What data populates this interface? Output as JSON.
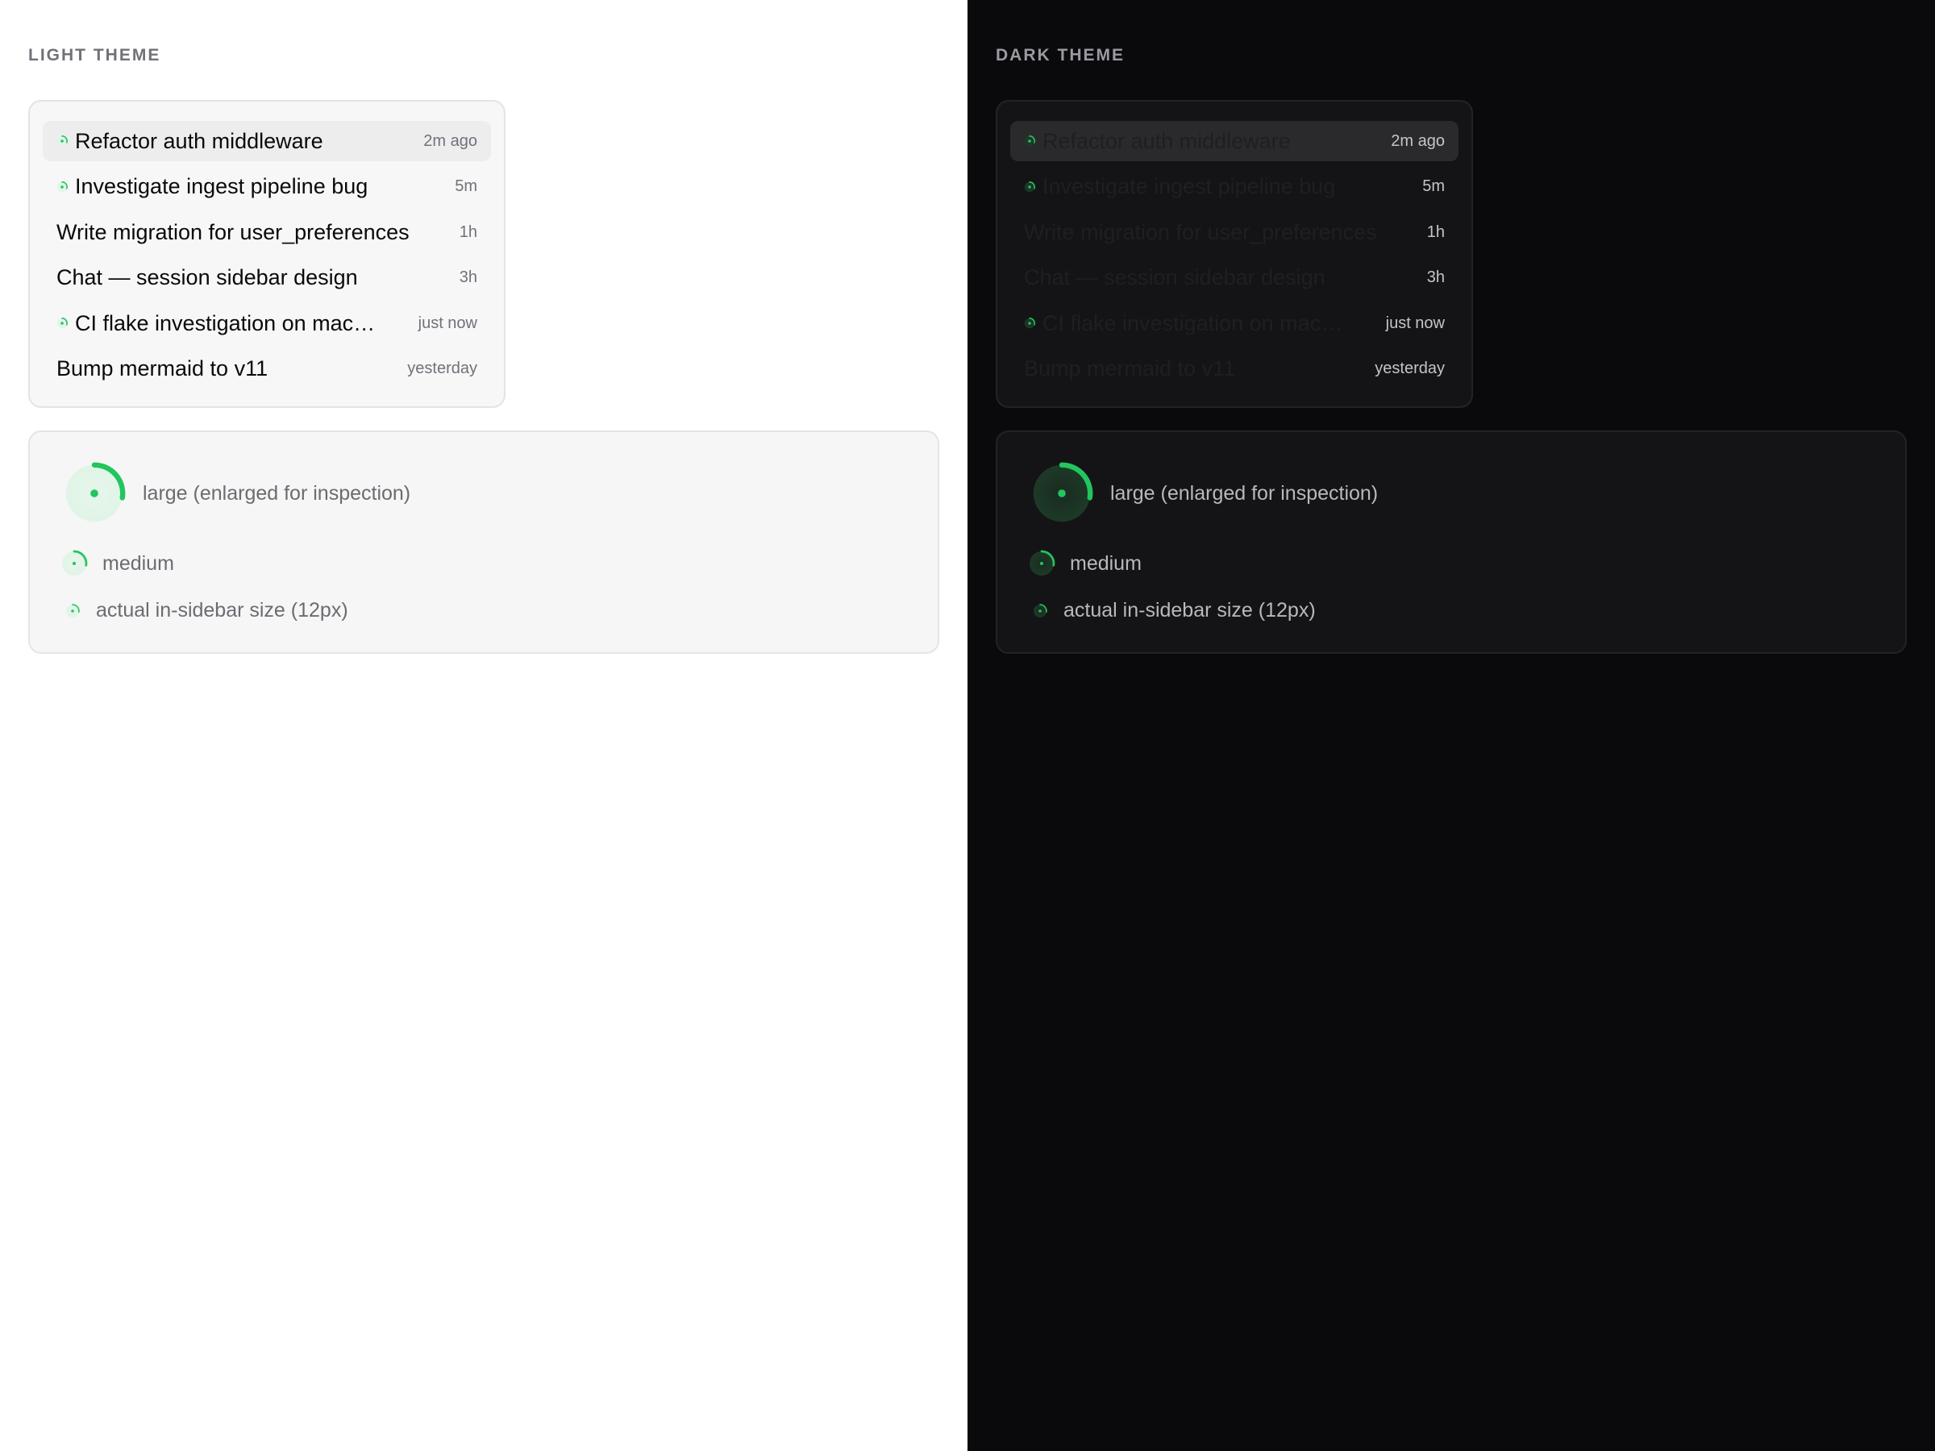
{
  "colors": {
    "accent": "#22c55e",
    "light_bg": "#ffffff",
    "dark_bg": "#0a0a0c"
  },
  "themes": [
    {
      "label": "LIGHT THEME",
      "sessions": [
        {
          "title": "Refactor auth middleware",
          "time": "2m ago",
          "running": true,
          "active": true
        },
        {
          "title": "Investigate ingest pipeline bug",
          "time": "5m",
          "running": true,
          "active": false
        },
        {
          "title": "Write migration for user_preferences",
          "time": "1h",
          "running": false,
          "active": false
        },
        {
          "title": "Chat — session sidebar design",
          "time": "3h",
          "running": false,
          "active": false
        },
        {
          "title": "CI flake investigation on mac…",
          "time": "just now",
          "running": true,
          "active": false
        },
        {
          "title": "Bump mermaid to v11",
          "time": "yesterday",
          "running": false,
          "active": false
        }
      ],
      "demo": {
        "large_label": "large (enlarged for inspection)",
        "medium_label": "medium",
        "small_label": "actual in-sidebar size (12px)"
      }
    },
    {
      "label": "DARK THEME",
      "sessions": [
        {
          "title": "Refactor auth middleware",
          "time": "2m ago",
          "running": true,
          "active": true
        },
        {
          "title": "Investigate ingest pipeline bug",
          "time": "5m",
          "running": true,
          "active": false
        },
        {
          "title": "Write migration for user_preferences",
          "time": "1h",
          "running": false,
          "active": false
        },
        {
          "title": "Chat — session sidebar design",
          "time": "3h",
          "running": false,
          "active": false
        },
        {
          "title": "CI flake investigation on mac…",
          "time": "just now",
          "running": true,
          "active": false
        },
        {
          "title": "Bump mermaid to v11",
          "time": "yesterday",
          "running": false,
          "active": false
        }
      ],
      "demo": {
        "large_label": "large (enlarged for inspection)",
        "medium_label": "medium",
        "small_label": "actual in-sidebar size (12px)"
      }
    }
  ]
}
